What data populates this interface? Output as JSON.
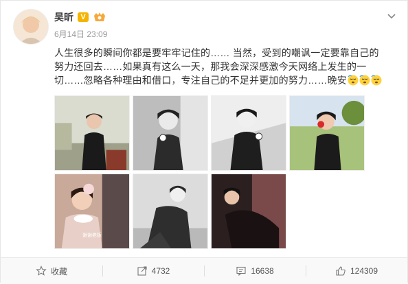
{
  "post": {
    "author": "吴昕",
    "verified_badge": "V",
    "time": "6月14日 23:09",
    "text": "人生很多的瞬间你都是要牢牢记住的…… 当然，受到的嘲讽一定要靠自己的努力还回去……如果真有这么一天，那我会深深感激今天网络上发生的一切……忽略各种理由和借口，专注自己的不足并更加的努力……晚安",
    "photo_watermark": "谢谢老板"
  },
  "actions": {
    "favorite_label": "收藏",
    "repost_count": "4732",
    "comment_count": "16638",
    "like_count": "124309"
  },
  "colors": {
    "accent": "#f5b400",
    "text": "#333333",
    "muted": "#999999"
  },
  "icons": [
    "chevron-down-icon",
    "verified-icon",
    "vip-icon",
    "star-icon",
    "repost-icon",
    "comment-icon",
    "like-icon",
    "emoji-sleepy-icon"
  ]
}
